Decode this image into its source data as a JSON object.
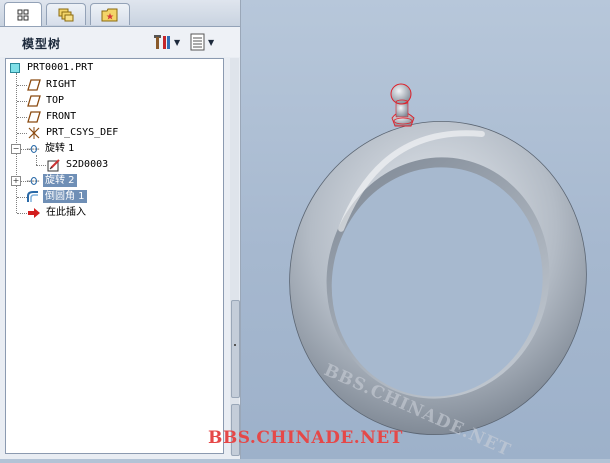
{
  "tabs": [
    {
      "name": "model-tree-tab",
      "icon": "model-tree-icon",
      "active": true
    },
    {
      "name": "layers-tab",
      "icon": "layers-icon",
      "active": false
    },
    {
      "name": "favorites-tab",
      "icon": "folder-star-icon",
      "active": false
    }
  ],
  "tree_header": {
    "title": "模型树",
    "settings_icon": "tools-icon",
    "show_icon": "list-view-icon"
  },
  "tree": {
    "root": "PRT0001.PRT",
    "items": [
      {
        "label": "RIGHT",
        "icon": "datum-plane-icon"
      },
      {
        "label": "TOP",
        "icon": "datum-plane-icon"
      },
      {
        "label": "FRONT",
        "icon": "datum-plane-icon"
      },
      {
        "label": "PRT_CSYS_DEF",
        "icon": "coordinate-system-icon"
      },
      {
        "label": "旋转 1",
        "icon": "revolve-icon",
        "expanded": true
      },
      {
        "label": "S2D0003",
        "icon": "sketch-icon"
      },
      {
        "label": "旋转 2",
        "icon": "revolve-icon",
        "selected": true
      },
      {
        "label": "倒圆角 1",
        "icon": "round-icon",
        "selected": true
      },
      {
        "label": "在此插入",
        "icon": "insert-here-arrow-icon"
      }
    ]
  },
  "viewport": {
    "watermark_on_ring": "BBS.CHINADE.NET",
    "watermark": "BBS.CHINADE.NET"
  },
  "colors": {
    "selection": "#6f8fb6",
    "highlight_edges": "#e0202a",
    "watermark": "#e54848",
    "viewport_bg": "#a9bbd1"
  }
}
